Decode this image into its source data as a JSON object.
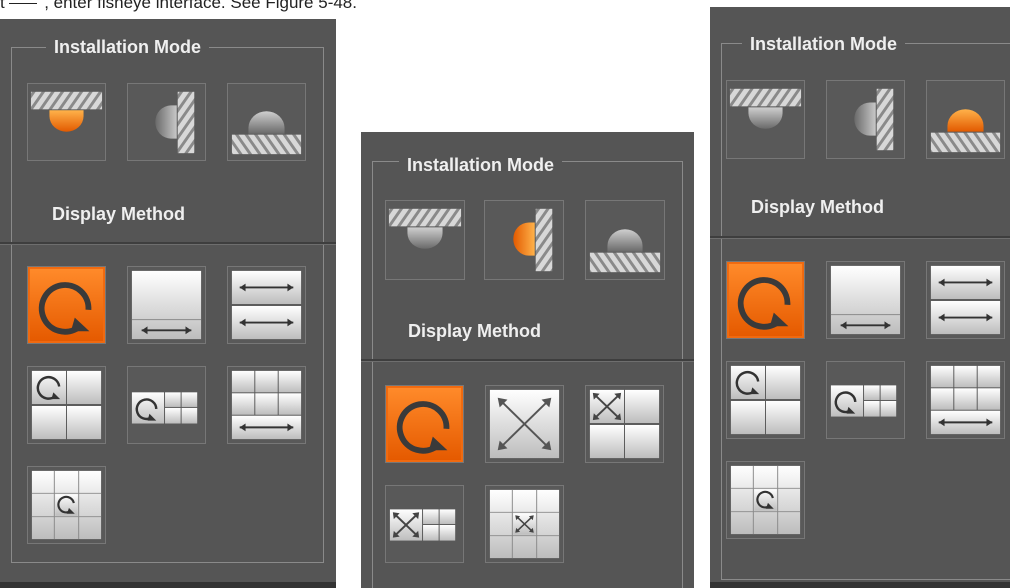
{
  "document": {
    "caption_prefix": "t",
    "caption": ", enter fisheye interface. See Figure 5-48."
  },
  "panels": [
    {
      "installation_title": "Installation Mode",
      "display_title": "Display Method",
      "selected_install": "ceiling",
      "selected_display": "original-view"
    },
    {
      "installation_title": "Installation Mode",
      "display_title": "Display Method",
      "selected_install": "wall",
      "selected_display": "original-view"
    },
    {
      "installation_title": "Installation Mode",
      "display_title": "Display Method",
      "selected_install": "ground",
      "selected_display": "original-view"
    }
  ],
  "colors": {
    "panel_bg": "#555555",
    "accent_orange": "#f07a1a",
    "title_text": "#efefef"
  }
}
